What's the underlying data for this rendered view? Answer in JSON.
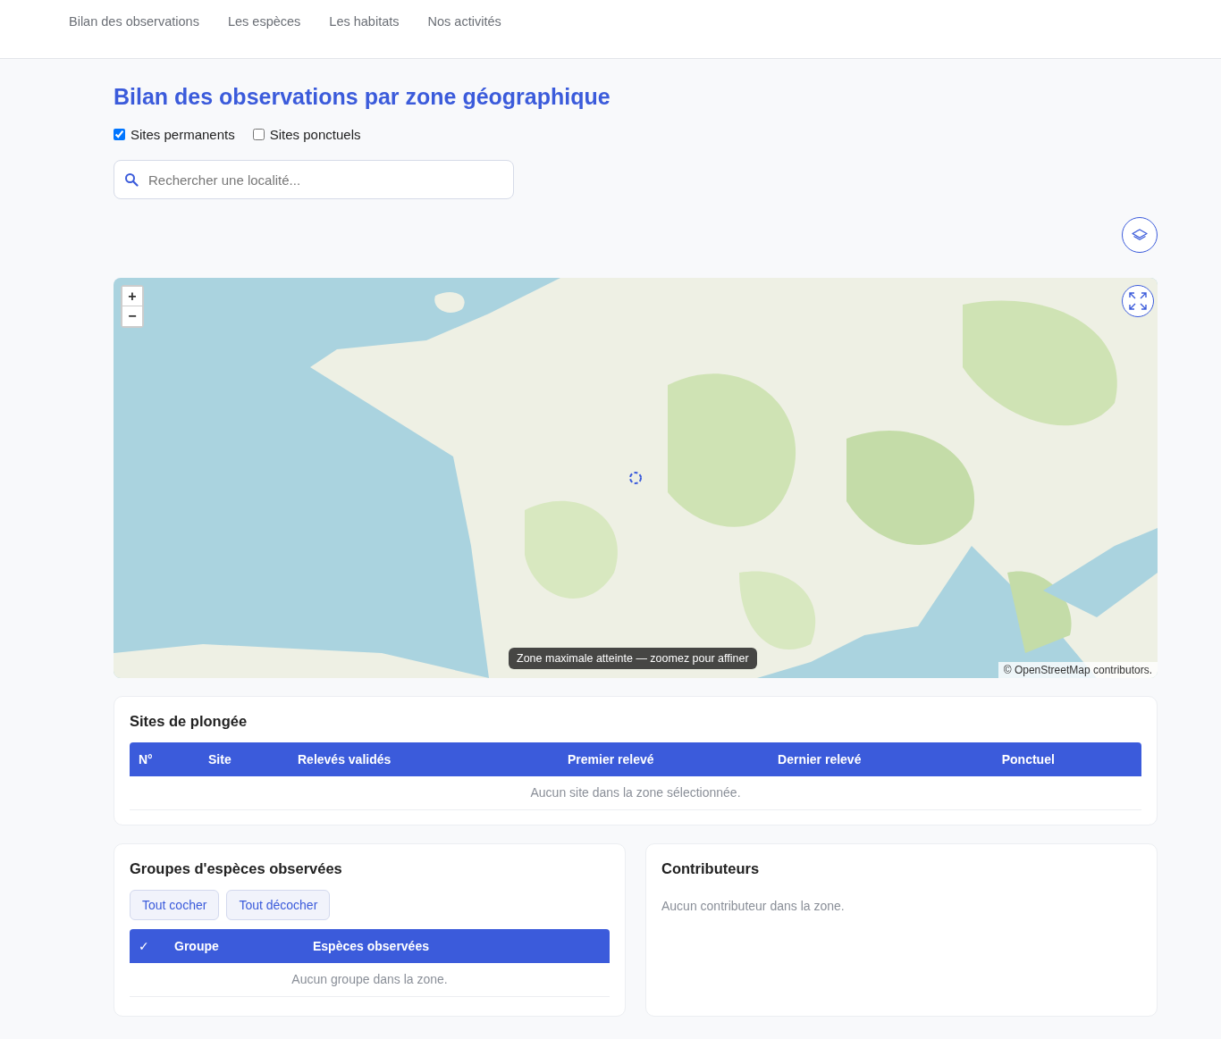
{
  "nav": {
    "items": [
      {
        "label": "Bilan des observations",
        "selected": false
      },
      {
        "label": "Les espèces",
        "selected": false
      },
      {
        "label": "Les habitats",
        "selected": false
      },
      {
        "label": "Nos activités",
        "selected": false
      }
    ]
  },
  "title": "Bilan des observations par zone géographique",
  "filters": [
    {
      "label": "Sites permanents",
      "checked": true
    },
    {
      "label": "Sites ponctuels",
      "checked": false
    }
  ],
  "search": {
    "placeholder": "Rechercher une localité..."
  },
  "map": {
    "zoom_in": "+",
    "zoom_out": "−",
    "tooltip": "Zone maximale atteinte — zoomez pour affiner",
    "attribution": "© OpenStreetMap contributors.",
    "loading": true
  },
  "sites": {
    "title": "Sites de plongée",
    "columns": [
      "N°",
      "Site",
      "Relevés validés",
      "Premier relevé",
      "Dernier relevé",
      "Ponctuel"
    ],
    "empty": "Aucun site dans la zone sélectionnée."
  },
  "groups": {
    "title": "Groupes d'espèces observées",
    "buttons": [
      "Tout cocher",
      "Tout décocher"
    ],
    "columns": [
      "✓",
      "Groupe",
      "Espèces observées"
    ],
    "empty": "Aucun groupe dans la zone."
  },
  "contributors": {
    "title": "Contributeurs",
    "empty": "Aucun contributeur dans la zone."
  }
}
